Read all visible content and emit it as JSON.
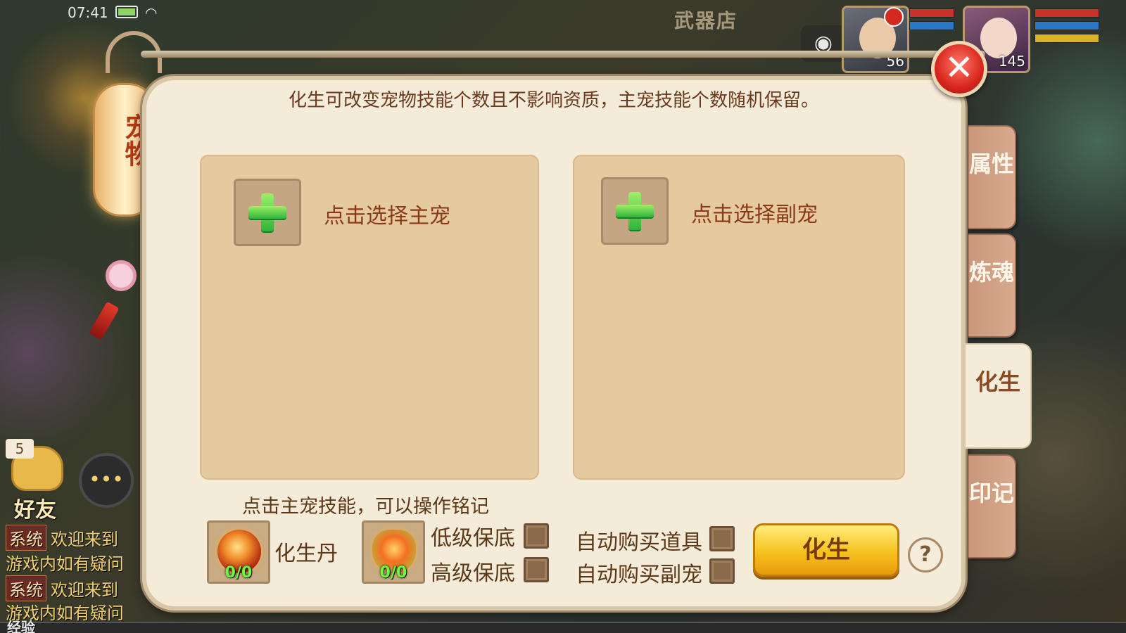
{
  "status_bar": {
    "time": "07:41"
  },
  "scene": {
    "shop_name": "武器店"
  },
  "hud": {
    "player_portrait": {
      "level": "56"
    },
    "pet_portrait": {
      "level": "145"
    },
    "friends": {
      "label": "好友",
      "count": "5"
    },
    "chat": {
      "lines": [
        {
          "tag": "系统",
          "text": "欢迎来到"
        },
        {
          "tag": "",
          "text": "游戏内如有疑问"
        },
        {
          "tag": "系统",
          "text": "欢迎来到"
        },
        {
          "tag": "",
          "text": "游戏内如有疑问"
        }
      ]
    },
    "exp_label": "经验"
  },
  "lantern": {
    "title": "宠物"
  },
  "panel": {
    "info_text": "化生可改变宠物技能个数且不影响资质，主宠技能个数随机保留。",
    "main_slot": {
      "label": "点击选择主宠"
    },
    "sub_slot": {
      "label": "点击选择副宠"
    },
    "hint": "点击主宠技能，可以操作铭记",
    "items": [
      {
        "name": "化生丹",
        "count": "0/0",
        "icon": "rebirth-pill-icon"
      },
      {
        "name": "",
        "count": "0/0",
        "icon": "guarantee-talisman-icon"
      }
    ],
    "options": {
      "low_guarantee": "低级保底",
      "high_guarantee": "高级保底",
      "auto_buy_item": "自动购买道具",
      "auto_buy_sub_pet": "自动购买副宠"
    },
    "action_button": "化生",
    "help_button": "?"
  },
  "tabs": [
    {
      "label": "属性",
      "active": false
    },
    {
      "label": "炼魂",
      "active": false
    },
    {
      "label": "化生",
      "active": true
    },
    {
      "label": "印记",
      "active": false
    }
  ],
  "colors": {
    "panel_bg": "#f4ebd9",
    "slot_bg": "#e5c99f",
    "text_brown": "#6a3a1e",
    "action_button": "#f6c21e",
    "close_button": "#d9261e",
    "plus_green": "#2fb43a",
    "count_green": "#6cff3a"
  }
}
